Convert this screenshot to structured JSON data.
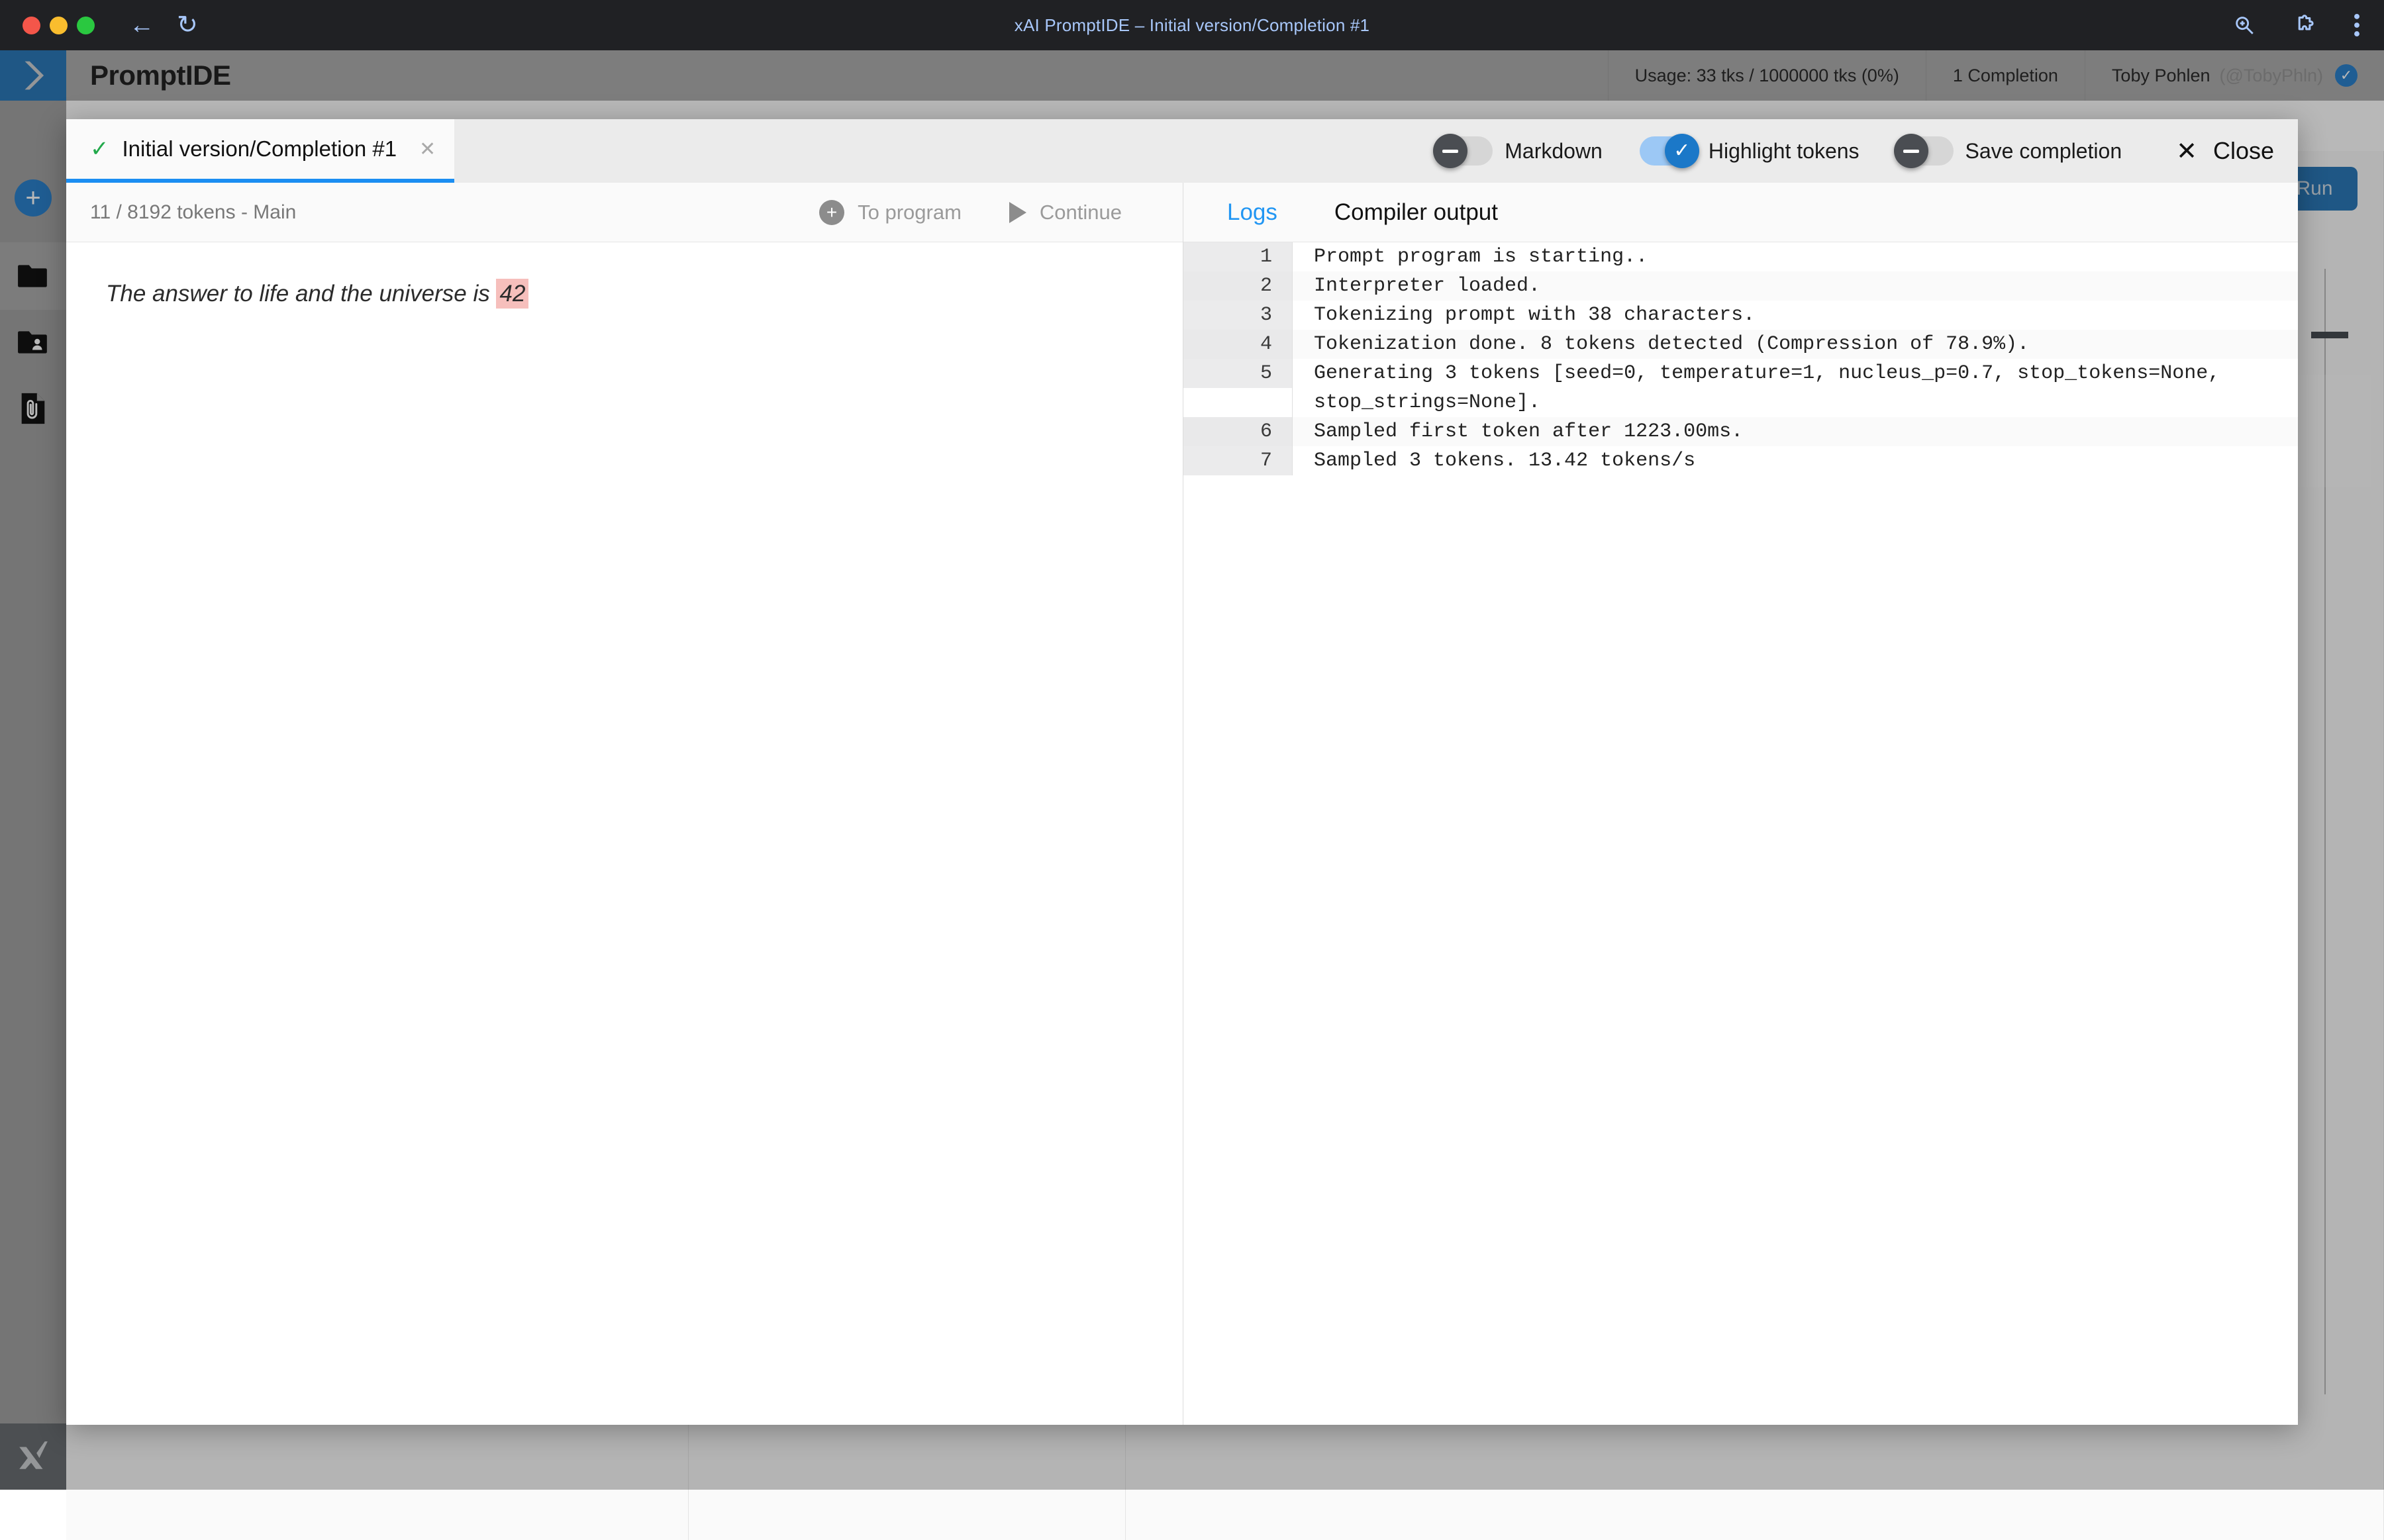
{
  "browser": {
    "window_title": "xAI PromptIDE – Initial version/Completion #1",
    "back_icon": "back-arrow-icon",
    "reload_icon": "reload-icon",
    "zoom_icon": "zoom-icon",
    "extensions_icon": "puzzle-piece-icon",
    "menu_icon": "three-dot-menu-icon"
  },
  "app": {
    "brand": "PromptIDE",
    "logo_icon": "chevron-logo-icon",
    "usage": "Usage: 33 tks / 1000000 tks (0%)",
    "completions": "1 Completion",
    "user_name": "Toby Pohlen",
    "user_handle": "(@TobyPhln)",
    "verified_icon": "verified-check-icon",
    "run_label": "Run"
  },
  "sidebar": {
    "items": [
      {
        "name": "add-button",
        "icon": "plus-icon"
      },
      {
        "name": "files-item",
        "icon": "folder-icon"
      },
      {
        "name": "shared-item",
        "icon": "shared-folder-icon"
      },
      {
        "name": "attachments-item",
        "icon": "document-attachment-icon"
      }
    ],
    "bottom_logo": "xai-logo"
  },
  "modal": {
    "tab": {
      "label": "Initial version/Completion #1",
      "check_icon": "check-icon",
      "close_icon": "close-icon"
    },
    "toggles": [
      {
        "label": "Markdown",
        "state": "off",
        "icon": "minus-icon"
      },
      {
        "label": "Highlight tokens",
        "state": "on",
        "icon": "check-icon"
      },
      {
        "label": "Save completion",
        "state": "off",
        "icon": "minus-icon"
      }
    ],
    "close": {
      "label": "Close",
      "icon": "x-icon"
    }
  },
  "editor": {
    "token_count": "11 / 8192 tokens - Main",
    "actions": [
      {
        "label": "To program",
        "icon": "plus-circle-icon"
      },
      {
        "label": "Continue",
        "icon": "play-icon"
      }
    ],
    "completion": {
      "prefix": "The answer to life and the universe is ",
      "highlight": "42"
    }
  },
  "logs": {
    "tabs": [
      {
        "label": "Logs",
        "active": true
      },
      {
        "label": "Compiler output",
        "active": false
      }
    ],
    "lines": [
      {
        "n": "1",
        "text": "Prompt program is starting.."
      },
      {
        "n": "2",
        "text": "Interpreter loaded."
      },
      {
        "n": "3",
        "text": "Tokenizing prompt with 38 characters."
      },
      {
        "n": "4",
        "text": "Tokenization done. 8 tokens detected (Compression of 78.9%)."
      },
      {
        "n": "5",
        "text": "Generating 3 tokens [seed=0, temperature=1, nucleus_p=0.7, stop_tokens=None, stop_strings=None]."
      },
      {
        "n": "6",
        "text": "Sampled first token after 1223.00ms."
      },
      {
        "n": "7",
        "text": "Sampled 3 tokens. 13.42 tokens/s"
      }
    ]
  },
  "colors": {
    "accent_blue": "#1b78c8",
    "link_blue": "#2196f3",
    "check_green": "#22a94b",
    "highlight_pink": "#f6bfbc",
    "chrome_dark": "#202124"
  }
}
